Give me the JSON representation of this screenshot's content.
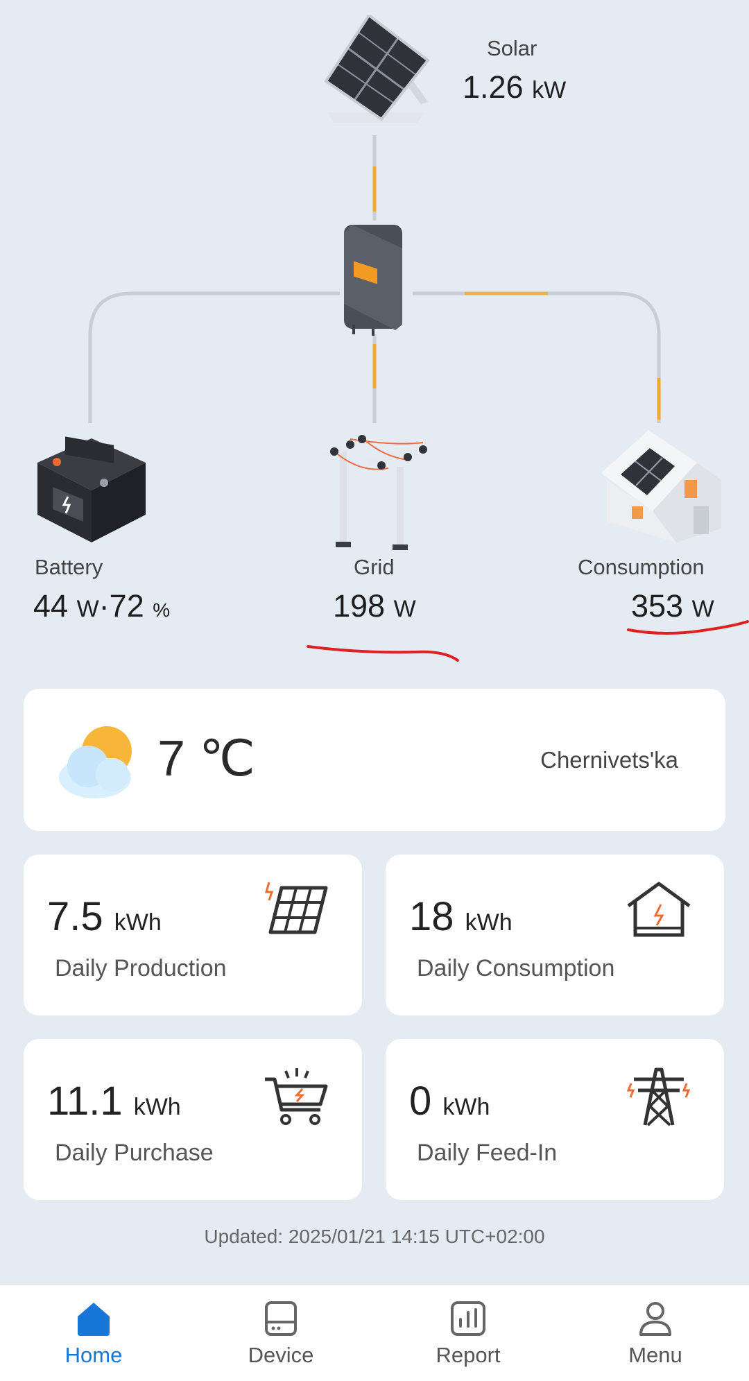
{
  "flow": {
    "solar": {
      "label": "Solar",
      "value": "1.26",
      "unit": "kW"
    },
    "battery": {
      "label": "Battery",
      "value": "44",
      "unit": "W",
      "sep": "·",
      "percent": "72",
      "percent_unit": "%"
    },
    "grid": {
      "label": "Grid",
      "value": "198",
      "unit": "W"
    },
    "consumption": {
      "label": "Consumption",
      "value": "353",
      "unit": "W"
    }
  },
  "weather": {
    "temperature": "7 ℃",
    "location": "Chernivets'ka",
    "icon": "partly-cloudy-icon"
  },
  "stats": [
    {
      "value": "7.5",
      "unit": "kWh",
      "label": "Daily Production",
      "icon": "solar-panel-icon"
    },
    {
      "value": "18",
      "unit": "kWh",
      "label": "Daily Consumption",
      "icon": "house-icon"
    },
    {
      "value": "11.1",
      "unit": "kWh",
      "label": "Daily Purchase",
      "icon": "cart-icon"
    },
    {
      "value": "0",
      "unit": "kWh",
      "label": "Daily Feed-In",
      "icon": "power-tower-icon"
    }
  ],
  "updated": "Updated: 2025/01/21 14:15 UTC+02:00",
  "tabs": [
    {
      "label": "Home",
      "icon": "home-icon",
      "active": true
    },
    {
      "label": "Device",
      "icon": "device-icon",
      "active": false
    },
    {
      "label": "Report",
      "icon": "report-icon",
      "active": false
    },
    {
      "label": "Menu",
      "icon": "user-icon",
      "active": false
    }
  ],
  "colors": {
    "accent": "#1677d9",
    "flow_active": "#f0a830",
    "flow_line": "#c9ced6",
    "annotation": "#e02020"
  }
}
